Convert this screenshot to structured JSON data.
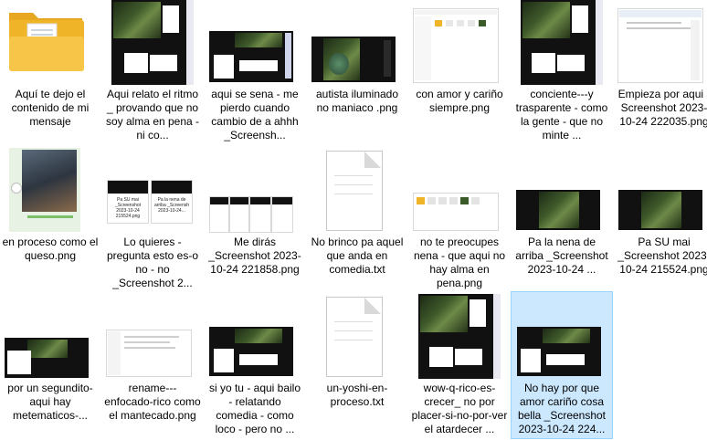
{
  "files": [
    {
      "label": "Aquí te dejo el contenido de mi mensaje",
      "icon": "folder-icon"
    },
    {
      "label": "Aqui relato el ritmo _ provando que no soy alma en pena - ni co..."
    },
    {
      "label": "aqui se sena - me pierdo cuando cambio de a ahhh _Screensh..."
    },
    {
      "label": "autista iluminado no maniaco .png"
    },
    {
      "label": "con amor y cariño siempre.png"
    },
    {
      "label": "conciente---y trasparente - como la gente - que no minte ..."
    },
    {
      "label": "Empieza por aqui - Screenshot 2023-10-24 222035.png"
    },
    {
      "label": "en proceso como el queso.png"
    },
    {
      "label": "Lo quieres -pregunta esto es-o no - no _Screenshot 2...",
      "thumb_text_left": "Pa SU mai _Screenshot 2023-10-24 215524.png",
      "thumb_text_right": "Pa la nena de arriba _Screensh 2023-10-24..."
    },
    {
      "label": "Me dirás _Screenshot 2023-10-24 221858.png"
    },
    {
      "label": "No brinco pa aquel que anda en comedia.txt",
      "icon": "text-file-icon"
    },
    {
      "label": "no te preocupes nena - que aqui no hay alma en pena.png"
    },
    {
      "label": "Pa la nena de arriba _Screenshot 2023-10-24 ..."
    },
    {
      "label": "Pa SU mai _Screenshot 2023-10-24 215524.png"
    },
    {
      "label": "por un segundito- aqui hay metematicos-..."
    },
    {
      "label": "rename---enfocado-rico como el mantecado.png"
    },
    {
      "label": "si yo tu - aqui bailo - relatando comedia - como loco - pero no ..."
    },
    {
      "label": "un-yoshi-en-proceso.txt",
      "icon": "text-file-icon"
    },
    {
      "label": "wow-q-rico-es-crecer_ no por placer-si-no-por-ver el atardecer ..."
    },
    {
      "label": "No hay por que amor cariño cosa bella _Screenshot 2023-10-24 224...",
      "selected": true
    }
  ]
}
